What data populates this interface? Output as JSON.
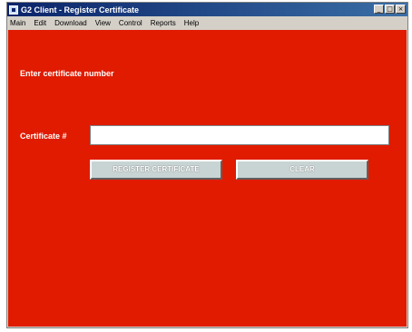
{
  "window": {
    "title": "G2 Client - Register Certificate",
    "controls": [
      "_",
      "□",
      "×"
    ]
  },
  "menu": {
    "items": [
      "Main",
      "Edit",
      "Download",
      "View",
      "Control",
      "Reports",
      "Help"
    ]
  },
  "form": {
    "prompt": "Enter certificate number",
    "certificate_label": "Certificate #",
    "certificate_value": "",
    "register_button": "REGISTER CERTIFICATE",
    "clear_button": "CLEAR"
  },
  "colors": {
    "background": "#e01b00",
    "titlebar": "#0a246a",
    "button": "#c8d4d4"
  }
}
